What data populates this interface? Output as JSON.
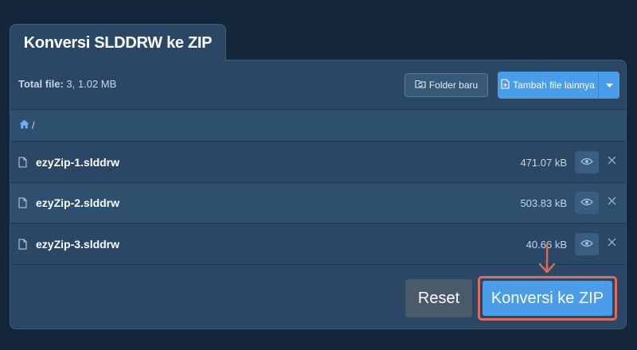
{
  "tab": {
    "title": "Konversi SLDDRW ke ZIP"
  },
  "toolbar": {
    "total_label": "Total file:",
    "total_value": " 3, 1.02 MB",
    "folder_button": "Folder baru",
    "add_button": "Tambah file lainnya"
  },
  "breadcrumb": {
    "separator": "/"
  },
  "files": [
    {
      "name": "ezyZip-1.slddrw",
      "size": "471.07 kB"
    },
    {
      "name": "ezyZip-2.slddrw",
      "size": "503.83 kB"
    },
    {
      "name": "ezyZip-3.slddrw",
      "size": "40.66 kB"
    }
  ],
  "actions": {
    "reset": "Reset",
    "convert": "Konversi ke ZIP"
  },
  "colors": {
    "background": "#13263a",
    "panel": "#2a4866",
    "accent": "#4a9de8",
    "highlight": "#e06b5c"
  },
  "icons": [
    "home-icon",
    "file-icon",
    "eye-icon",
    "close-icon",
    "folder-refresh-icon",
    "add-file-icon",
    "caret-down-icon",
    "arrow-down-icon"
  ]
}
